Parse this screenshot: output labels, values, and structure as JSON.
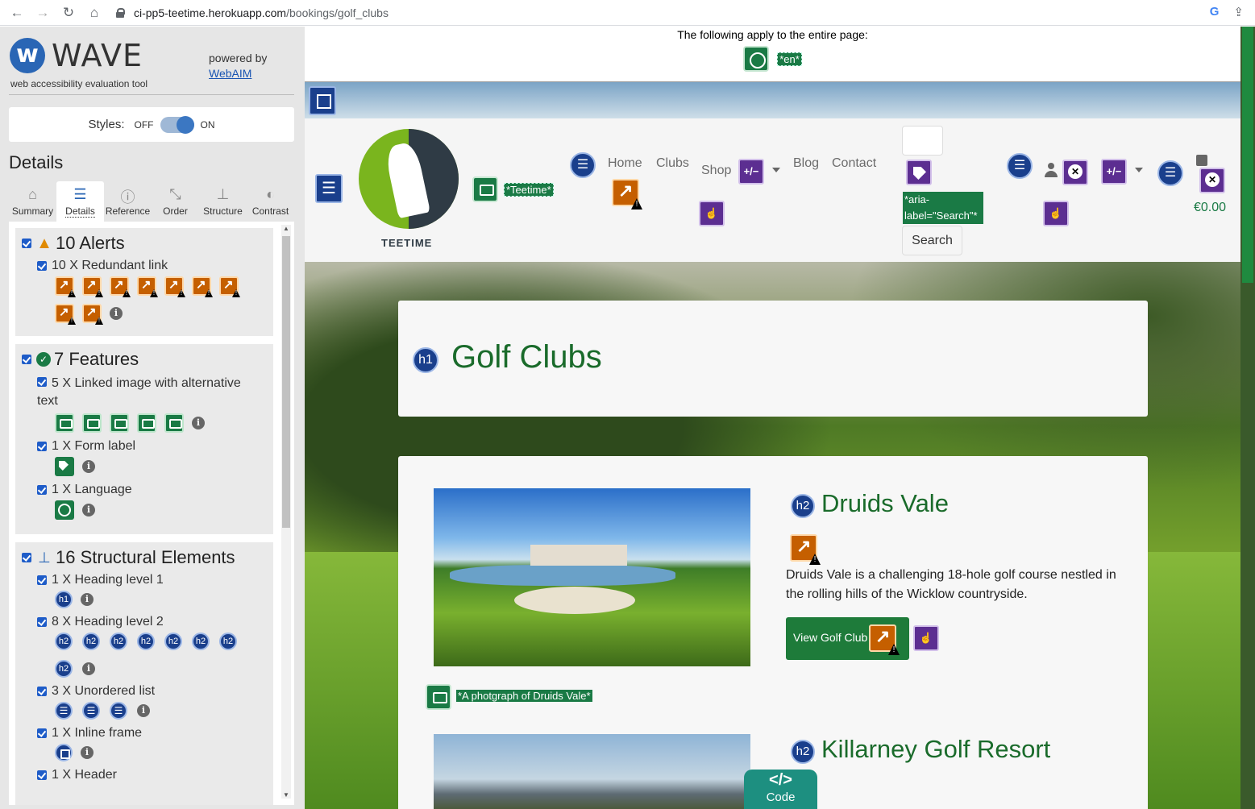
{
  "browser": {
    "url_host": "ci-pp5-teetime.herokuapp.com",
    "url_path": "/bookings/golf_clubs",
    "google_icon": "G"
  },
  "wave": {
    "logo_text": "WAVE",
    "tagline": "web accessibility evaluation tool",
    "powered_by": "powered by",
    "webaim_link": "WebAIM",
    "styles_label": "Styles:",
    "styles_off": "OFF",
    "styles_on": "ON",
    "details_title": "Details",
    "tabs": [
      {
        "label": "Summary",
        "icon": "home-icon"
      },
      {
        "label": "Details",
        "icon": "list-icon"
      },
      {
        "label": "Reference",
        "icon": "info-icon"
      },
      {
        "label": "Order",
        "icon": "order-icon"
      },
      {
        "label": "Structure",
        "icon": "structure-icon"
      },
      {
        "label": "Contrast",
        "icon": "contrast-icon"
      }
    ],
    "sections": {
      "alerts": {
        "title": "10 Alerts",
        "items": [
          {
            "label": "10 X Redundant link",
            "count": 10
          }
        ]
      },
      "features": {
        "title": "7 Features",
        "items": [
          {
            "label": "5 X Linked image with alternative text",
            "count": 5
          },
          {
            "label": "1 X Form label",
            "count": 1
          },
          {
            "label": "1 X Language",
            "count": 1
          }
        ]
      },
      "structure": {
        "title": "16 Structural Elements",
        "items": [
          {
            "label": "1 X Heading level 1",
            "count": 1
          },
          {
            "label": "8 X Heading level 2",
            "count": 8
          },
          {
            "label": "3 X Unordered list",
            "count": 3
          },
          {
            "label": "1 X Inline frame",
            "count": 1
          },
          {
            "label": "1 X Header",
            "count": 1
          }
        ]
      }
    },
    "info_glyph": "i",
    "h1_glyph": "h1",
    "h2_glyph": "h2"
  },
  "page": {
    "lang_banner_text": "The following apply to the entire page:",
    "lang_value": "*en*",
    "logo_alt": "*Teetime*",
    "logo_word": "TEETIME",
    "nav": {
      "home": "Home",
      "clubs": "Clubs",
      "shop": "Shop",
      "blog": "Blog",
      "contact": "Contact",
      "plus_minus": "+/−"
    },
    "search_aria": "*aria-label=\"Search\"*",
    "search_button": "Search",
    "cart_total": "€0.00",
    "title": "Golf Clubs",
    "clubs": [
      {
        "name": "Druids Vale",
        "description": "Druids Vale is a challenging 18-hole golf course nestled in the rolling hills of the Wicklow countryside.",
        "button": "View Golf Club",
        "alt": "*A photgraph of Druids Vale*"
      },
      {
        "name": "Killarney Golf Resort"
      }
    ],
    "code_symbol": "</>",
    "code_label": "Code"
  },
  "colors": {
    "brand_green": "#1a7a45",
    "heading_green": "#1a6b2b",
    "wave_blue": "#2a66b5",
    "alert_orange": "#c55f00",
    "structure_blue": "#1a3f8c",
    "aria_purple": "#5c2e91"
  }
}
